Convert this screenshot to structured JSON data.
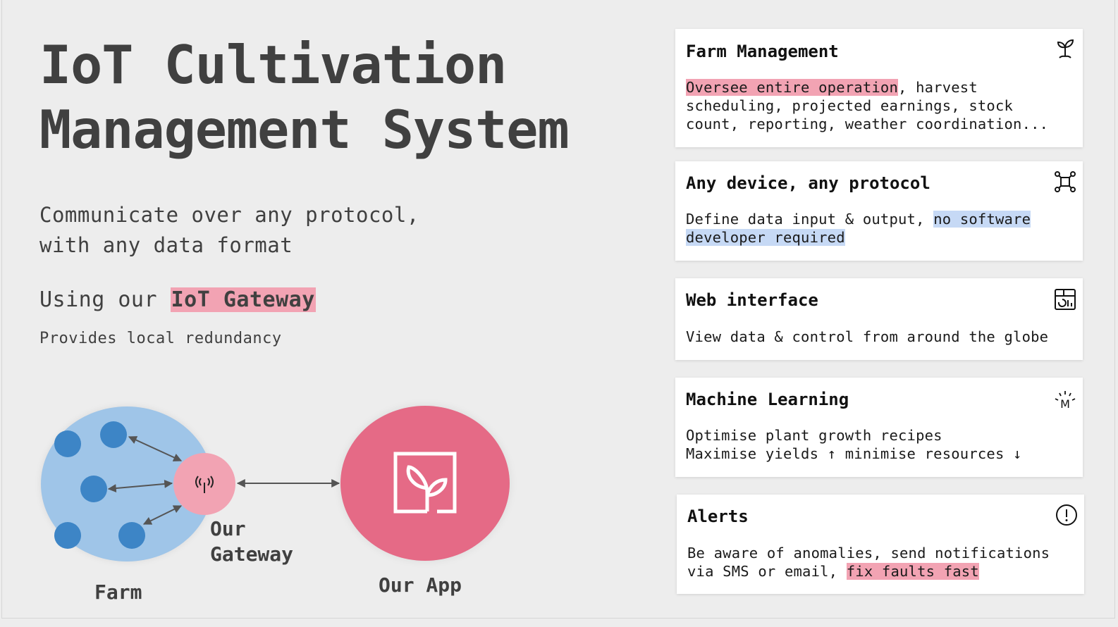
{
  "header": {
    "title_line1": "IoT Cultivation",
    "title_line2": "Management System"
  },
  "intro": {
    "subtitle_line1": "Communicate over any protocol,",
    "subtitle_line2": "with any data format",
    "using_prefix": "Using our ",
    "using_highlight": "IoT Gateway",
    "provides": "Provides local redundancy"
  },
  "diagram": {
    "farm_label": "Farm",
    "gateway_label_line1": "Our",
    "gateway_label_line2": "Gateway",
    "app_label": "Our App",
    "sensor_count": 5,
    "gateway_icon": "antenna-icon",
    "app_icon": "sprout-logo-icon"
  },
  "colors": {
    "background": "#ededed",
    "text": "#404040",
    "highlight_pink": "#f2a3b3",
    "highlight_blue": "#c6d9f5",
    "farm_circle": "#9fc5e8",
    "sensor": "#3d85c6",
    "gateway": "#f2a3b3",
    "app": "#e56a86"
  },
  "cards": [
    {
      "title": "Farm Management",
      "icon": "sprout-icon",
      "body_highlight": "Oversee entire operation",
      "body_rest": ", harvest\nscheduling, projected earnings, stock\ncount, reporting, weather coordination..."
    },
    {
      "title": "Any device, any protocol",
      "icon": "network-nodes-icon",
      "body_prefix": "Define data input & output, ",
      "body_highlight": "no software\ndeveloper required"
    },
    {
      "title": "Web interface",
      "icon": "dashboard-icon",
      "body": "View data & control from around the globe"
    },
    {
      "title": "Machine Learning",
      "icon": "machine-learning-icon",
      "body": "Optimise plant growth recipes\nMaximise yields ↑ minimise resources ↓"
    },
    {
      "title": "Alerts",
      "icon": "alert-icon",
      "body_prefix": "Be aware of anomalies, send notifications\nvia SMS or email, ",
      "body_highlight": "fix faults fast"
    }
  ]
}
